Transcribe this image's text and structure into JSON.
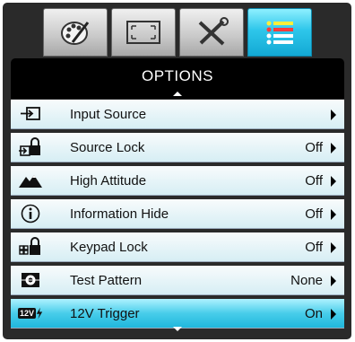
{
  "tabs": [
    {
      "icon": "palette-icon",
      "active": false
    },
    {
      "icon": "screen-resize-icon",
      "active": false
    },
    {
      "icon": "tools-icon",
      "active": false
    },
    {
      "icon": "list-menu-icon",
      "active": true
    }
  ],
  "header": {
    "title": "OPTIONS"
  },
  "options": [
    {
      "label": "Input Source",
      "value": "",
      "icon": "input-source-icon",
      "selected": false
    },
    {
      "label": "Source Lock",
      "value": "Off",
      "icon": "source-lock-icon",
      "selected": false
    },
    {
      "label": "High Attitude",
      "value": "Off",
      "icon": "high-altitude-icon",
      "selected": false
    },
    {
      "label": "Information Hide",
      "value": "Off",
      "icon": "info-icon",
      "selected": false
    },
    {
      "label": "Keypad Lock",
      "value": "Off",
      "icon": "keypad-lock-icon",
      "selected": false
    },
    {
      "label": "Test Pattern",
      "value": "None",
      "icon": "test-pattern-icon",
      "selected": false
    },
    {
      "label": "12V Trigger",
      "value": "On",
      "icon": "12v-trigger-icon",
      "icon_text": "12V",
      "selected": true
    }
  ],
  "colors": {
    "accent": "#1fb7dc",
    "header": "#000000",
    "frame": "#2a2a2a"
  }
}
